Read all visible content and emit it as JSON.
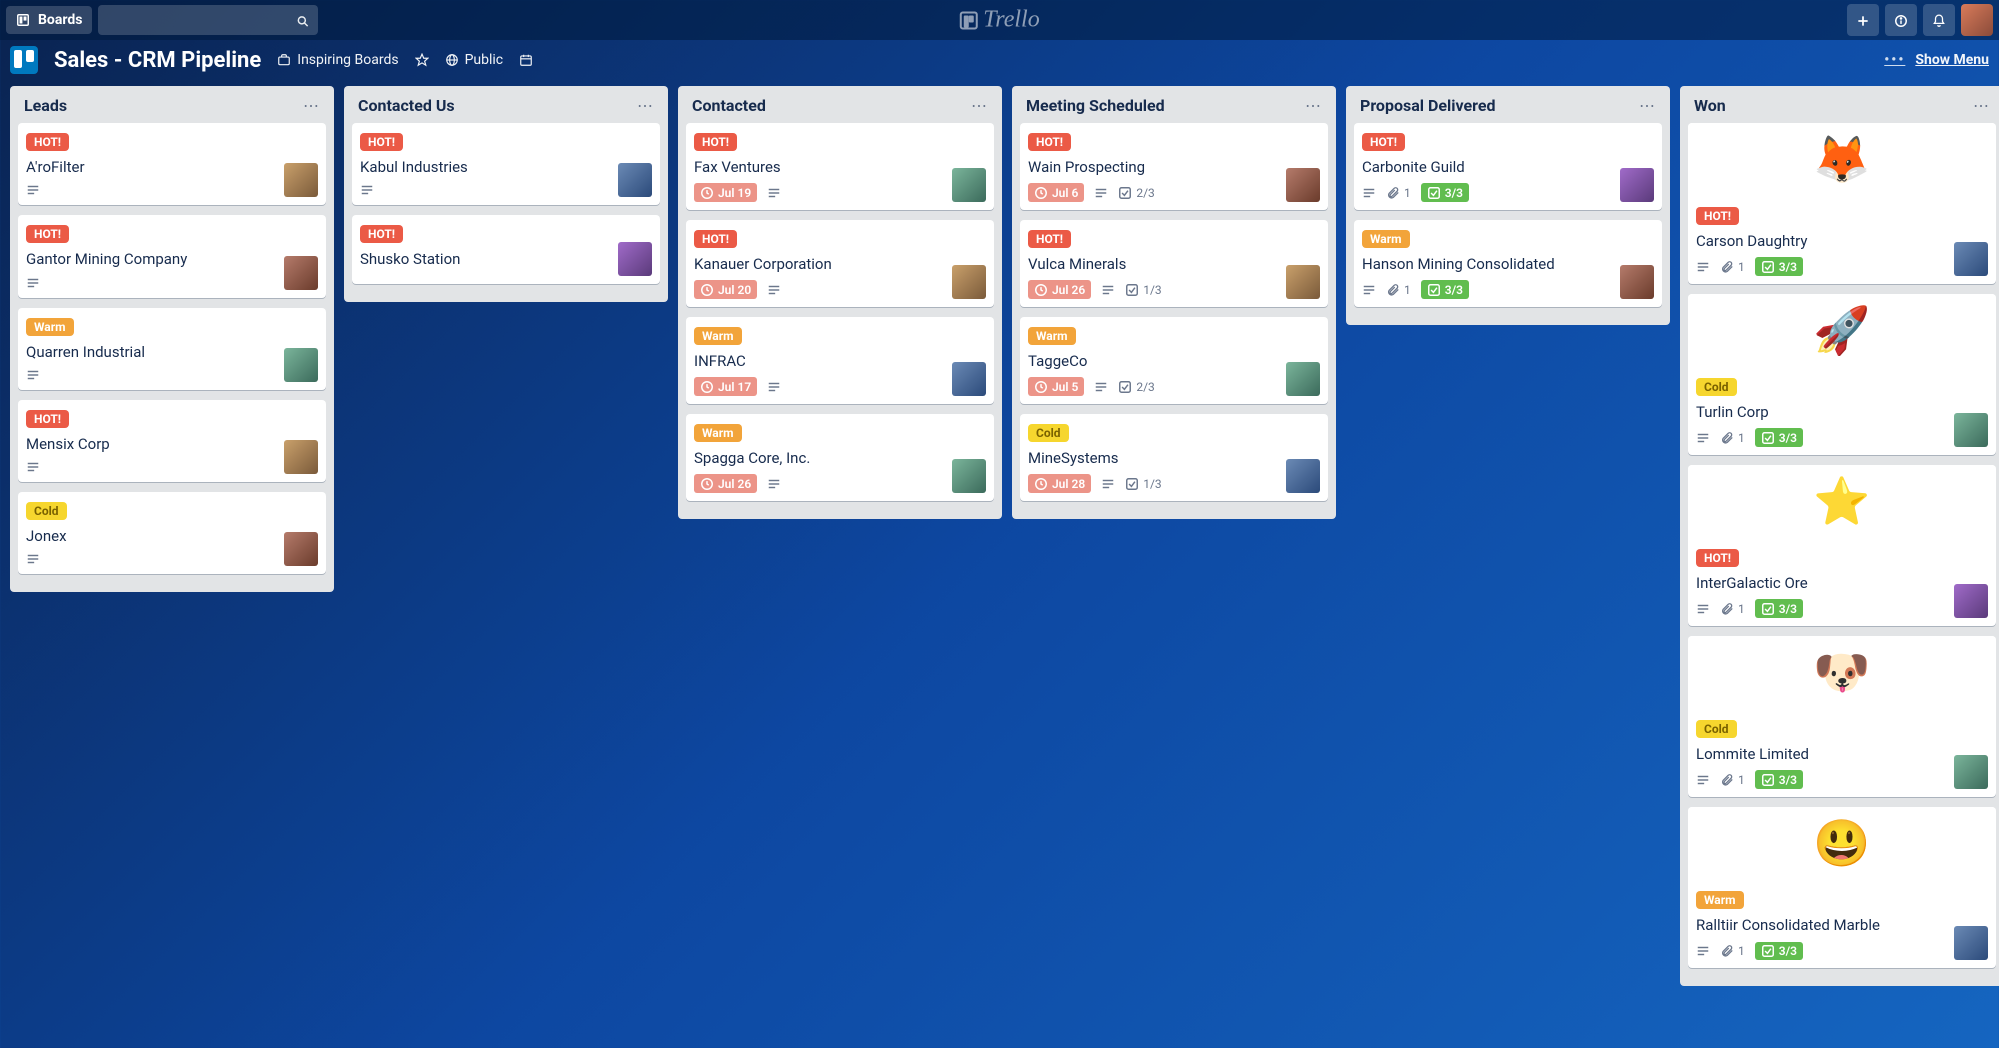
{
  "topbar": {
    "boards_label": "Boards",
    "brand": "Trello"
  },
  "board_header": {
    "title": "Sales - CRM Pipeline",
    "inspiring_label": "Inspiring Boards",
    "visibility": "Public",
    "show_menu": "Show Menu"
  },
  "labels": {
    "hot": "HOT!",
    "warm": "Warm",
    "cold": "Cold"
  },
  "lists": [
    {
      "title": "Leads",
      "cards": [
        {
          "label": "hot",
          "title": "A'roFilter",
          "desc": true,
          "avatar": "ava-1"
        },
        {
          "label": "hot",
          "title": "Gantor Mining Company",
          "desc": true,
          "avatar": "ava-2"
        },
        {
          "label": "warm",
          "title": "Quarren Industrial",
          "desc": true,
          "avatar": "ava-3"
        },
        {
          "label": "hot",
          "title": "Mensix Corp",
          "desc": true,
          "avatar": "ava-1"
        },
        {
          "label": "cold",
          "title": "Jonex",
          "desc": true,
          "avatar": "ava-2"
        }
      ]
    },
    {
      "title": "Contacted Us",
      "cards": [
        {
          "label": "hot",
          "title": "Kabul Industries",
          "desc": true,
          "avatar": "ava-4"
        },
        {
          "label": "hot",
          "title": "Shusko Station",
          "desc": false,
          "avatar": "ava-5"
        }
      ]
    },
    {
      "title": "Contacted",
      "cards": [
        {
          "label": "hot",
          "title": "Fax Ventures",
          "date": "Jul 19",
          "desc": true,
          "avatar": "ava-3"
        },
        {
          "label": "hot",
          "title": "Kanauer Corporation",
          "date": "Jul 20",
          "desc": true,
          "avatar": "ava-1"
        },
        {
          "label": "warm",
          "title": "INFRAC",
          "date": "Jul 17",
          "desc": true,
          "avatar": "ava-4"
        },
        {
          "label": "warm",
          "title": "Spagga Core, Inc.",
          "date": "Jul 26",
          "desc": true,
          "avatar": "ava-3"
        }
      ]
    },
    {
      "title": "Meeting Scheduled",
      "cards": [
        {
          "label": "hot",
          "title": "Wain Prospecting",
          "date": "Jul 6",
          "desc": true,
          "checklist": "2/3",
          "avatar": "ava-2"
        },
        {
          "label": "hot",
          "title": "Vulca Minerals",
          "date": "Jul 26",
          "desc": true,
          "checklist": "1/3",
          "avatar": "ava-1"
        },
        {
          "label": "warm",
          "title": "TaggeCo",
          "date": "Jul 5",
          "desc": true,
          "checklist": "2/3",
          "avatar": "ava-3"
        },
        {
          "label": "cold",
          "title": "MineSystems",
          "date": "Jul 28",
          "desc": true,
          "checklist": "1/3",
          "avatar": "ava-4"
        }
      ]
    },
    {
      "title": "Proposal Delivered",
      "cards": [
        {
          "label": "hot",
          "title": "Carbonite Guild",
          "desc": true,
          "attach": "1",
          "checklist_done": "3/3",
          "avatar": "ava-5"
        },
        {
          "label": "warm",
          "title": "Hanson Mining Consolidated",
          "desc": true,
          "attach": "1",
          "checklist_done": "3/3",
          "avatar": "ava-2"
        }
      ]
    },
    {
      "title": "Won",
      "cards": [
        {
          "cover": "🦊",
          "label": "hot",
          "title": "Carson Daughtry",
          "desc": true,
          "attach": "1",
          "checklist_done": "3/3",
          "avatar": "ava-4"
        },
        {
          "cover": "🚀",
          "label": "cold",
          "title": "Turlin Corp",
          "desc": true,
          "attach": "1",
          "checklist_done": "3/3",
          "avatar": "ava-3"
        },
        {
          "cover": "⭐",
          "label": "hot",
          "title": "InterGalactic Ore",
          "desc": true,
          "attach": "1",
          "checklist_done": "3/3",
          "avatar": "ava-5"
        },
        {
          "cover": "🐶",
          "label": "cold",
          "title": "Lommite Limited",
          "desc": true,
          "attach": "1",
          "checklist_done": "3/3",
          "avatar": "ava-3"
        },
        {
          "cover": "😃",
          "label": "warm",
          "title": "Ralltiir Consolidated Marble",
          "desc": true,
          "attach": "1",
          "checklist_done": "3/3",
          "avatar": "ava-4"
        }
      ]
    }
  ]
}
